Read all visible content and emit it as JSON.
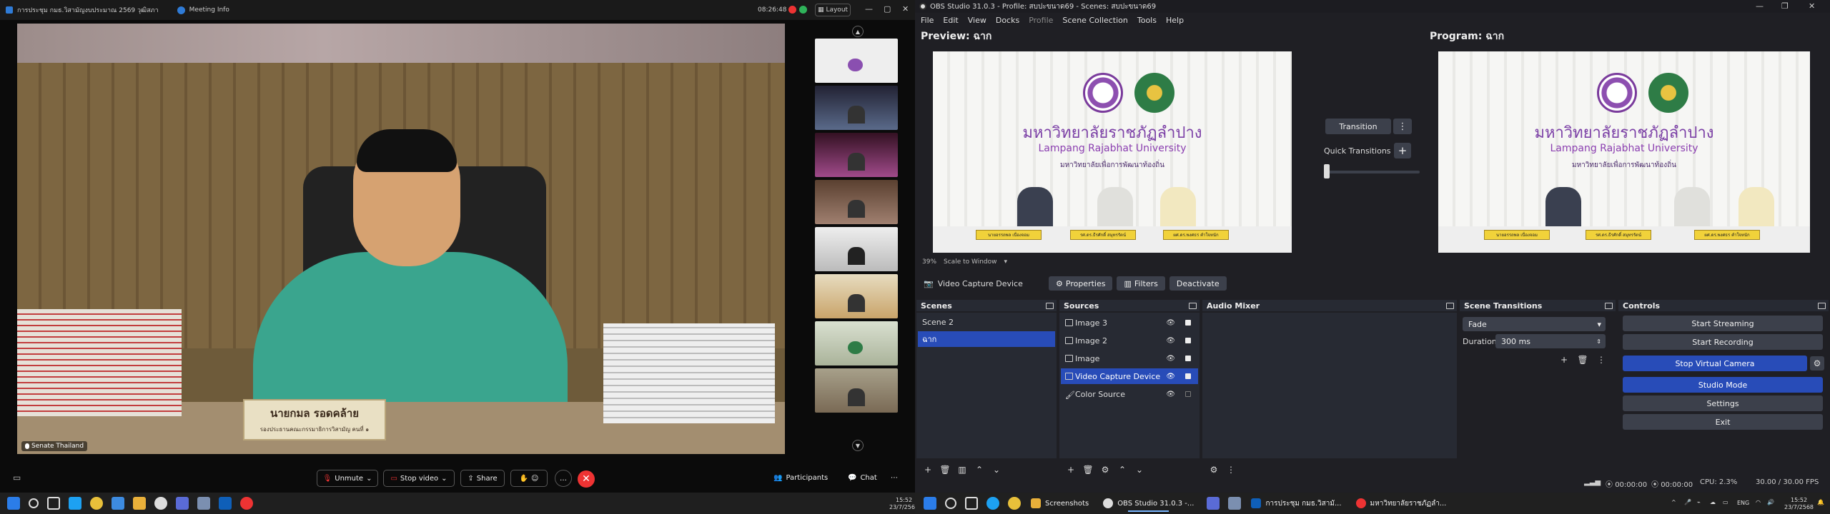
{
  "zoom": {
    "meeting_title": "การประชุม กมธ.วิสามัญงบประมาณ 2569 วุฒิสภา",
    "meeting_info": "Meeting Info",
    "time": "08:26:48",
    "layout_label": "Layout",
    "speaker_name": "Senate Thailand",
    "nameplate_line1": "นายกมล รอดคล้าย",
    "nameplate_line2": "รองประธานคณะกรรมาธิการวิสามัญ คนที่ ๑",
    "toolbar": {
      "unmute": "Unmute",
      "stop_video": "Stop video",
      "share": "Share",
      "participants": "Participants",
      "chat": "Chat"
    }
  },
  "taskbar_left": {
    "time": "15:52",
    "date": "23/7/2568"
  },
  "obs": {
    "window_title": "OBS Studio 31.0.3 - Profile: สบปะขนาด69 - Scenes: สบปะขนาด69",
    "menu": [
      "File",
      "Edit",
      "View",
      "Docks",
      "Profile",
      "Scene Collection",
      "Tools",
      "Help"
    ],
    "preview_label": "Preview: ฉาก",
    "program_label": "Program: ฉาก",
    "zoom_level": "39%",
    "scale_label": "Scale to Window",
    "transition_label": "Transition",
    "quick_transitions": "Quick Transitions",
    "stage": {
      "thai_name": "มหาวิทยาลัยราชภัฏลำปาง",
      "english_name": "Lampang Rajabhat University",
      "subtitle": "มหาวิทยาลัยเพื่อการพัฒนาท้องถิ่น",
      "nameplates": [
        "นายอรรถพล เนื่องจอม",
        "รศ.ดร.ธีรศักดิ์ สมุทรรัตน์",
        "ผศ.ดร.พงศธร คำใจหนัก"
      ]
    },
    "source_bar": {
      "source_name": "Video Capture Device",
      "properties": "Properties",
      "filters": "Filters",
      "deactivate": "Deactivate"
    },
    "docks": {
      "scenes_title": "Scenes",
      "scenes": [
        "Scene 2",
        "ฉาก"
      ],
      "selected_scene": 1,
      "sources_title": "Sources",
      "sources": [
        "Image 3",
        "Image 2",
        "Image",
        "Video Capture Device",
        "Color Source"
      ],
      "audio_title": "Audio Mixer",
      "transitions_title": "Scene Transitions",
      "transition_type": "Fade",
      "duration_label": "Duration",
      "duration_value": "300 ms",
      "controls_title": "Controls",
      "controls": [
        "Start Streaming",
        "Start Recording",
        "Stop Virtual Camera",
        "Studio Mode",
        "Settings",
        "Exit"
      ]
    },
    "status": {
      "rec_time1": "00:00:00",
      "rec_time2": "00:00:00",
      "cpu": "CPU: 2.3%",
      "fps": "30.00 / 30.00 FPS"
    }
  },
  "taskbar_right": {
    "apps": [
      "Screenshots",
      "OBS Studio 31.0.3 -...",
      "การประชุม กมธ.วิสามั...",
      "มหาวิทยาลัยราชภัฏลำ..."
    ],
    "lang": "ENG",
    "time": "15:52",
    "date": "23/7/2568"
  }
}
